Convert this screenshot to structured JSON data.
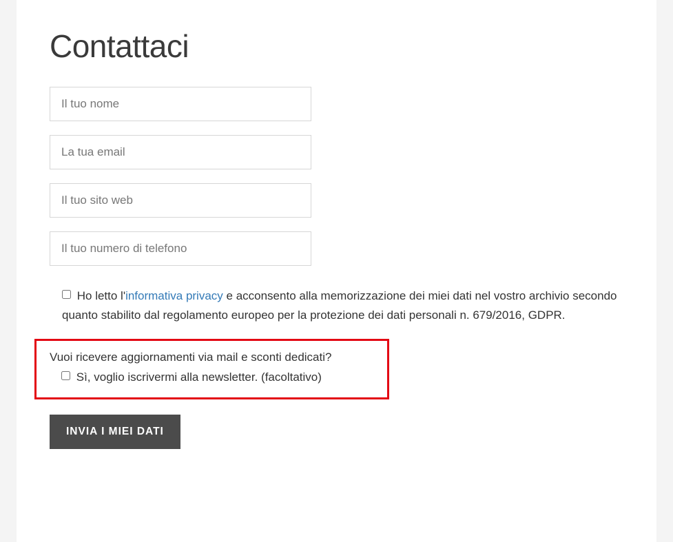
{
  "title": "Contattaci",
  "fields": {
    "name_placeholder": "Il tuo nome",
    "email_placeholder": "La tua email",
    "website_placeholder": "Il tuo sito web",
    "phone_placeholder": "Il tuo numero di telefono"
  },
  "consent": {
    "text_before_link": "Ho letto l'",
    "link_text": "informativa privacy",
    "text_after_link": " e acconsento alla memorizzazione dei miei dati nel vostro archivio secondo quanto stabilito dal regolamento europeo per la protezione dei dati personali n. 679/2016, GDPR."
  },
  "newsletter": {
    "question": "Vuoi ricevere aggiornamenti via mail e sconti dedicati?",
    "optin_label": "Sì, voglio iscrivermi alla newsletter. (facoltativo)"
  },
  "submit_label": "INVIA I MIEI DATI"
}
